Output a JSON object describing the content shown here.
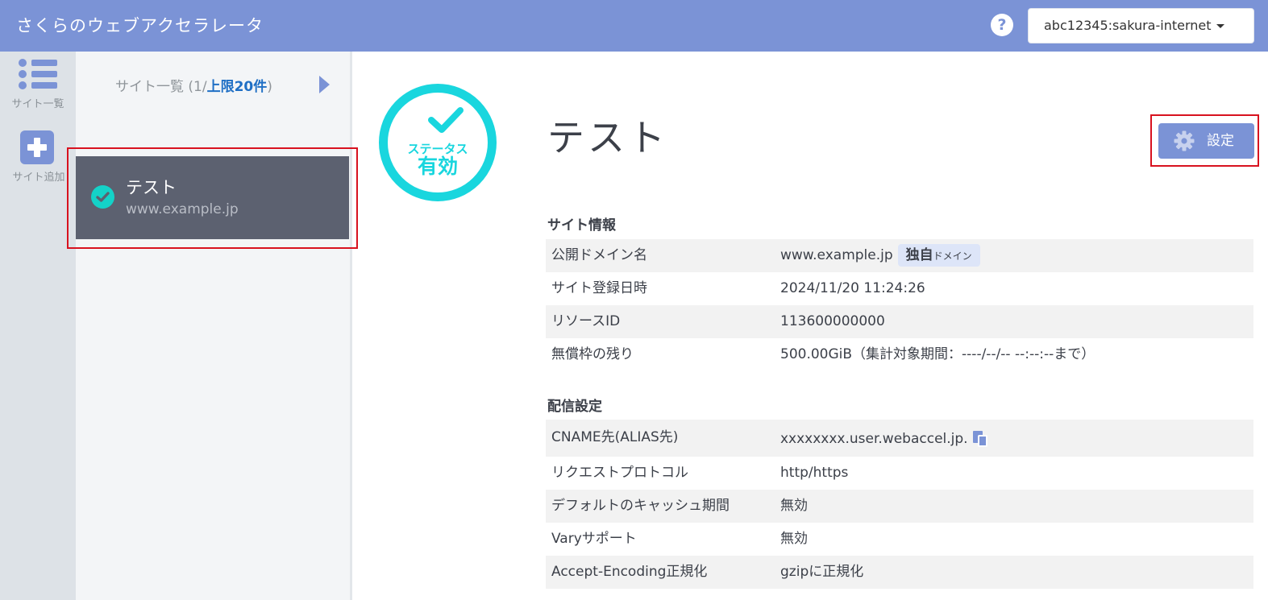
{
  "header": {
    "app_title": "さくらのウェブアクセラレータ",
    "help_glyph": "?",
    "account": "abc12345:sakura-internet"
  },
  "rail": {
    "site_list_label": "サイト一覧",
    "add_site_label": "サイト追加"
  },
  "site_panel": {
    "heading_prefix": "サイト一覧 (1/",
    "heading_limit": "上限20件",
    "heading_suffix": ")",
    "sites": [
      {
        "name": "テスト",
        "domain": "www.example.jp",
        "status": "active"
      }
    ]
  },
  "status": {
    "label": "ステータス",
    "value": "有効",
    "color": "#19d6de"
  },
  "main": {
    "title": "テスト",
    "settings_label": "設定"
  },
  "site_info": {
    "title": "サイト情報",
    "domain_label": "公開ドメイン名",
    "domain_value": "www.example.jp",
    "domain_tag_strong": "独自",
    "domain_tag_small": "ドメイン",
    "registered_label": "サイト登録日時",
    "registered_value": "2024/11/20 11:24:26",
    "resource_label": "リソースID",
    "resource_value": "113600000000",
    "quota_label": "無償枠の残り",
    "quota_value": "500.00GiB（集計対象期間：----/--/-- --:--:--まで）"
  },
  "delivery": {
    "title": "配信設定",
    "cname_label": "CNAME先(ALIAS先)",
    "cname_value": "xxxxxxxx.user.webaccel.jp.",
    "protocol_label": "リクエストプロトコル",
    "protocol_value": "http/https",
    "cache_label": "デフォルトのキャッシュ期間",
    "cache_value": "無効",
    "vary_label": "Varyサポート",
    "vary_value": "無効",
    "encoding_label": "Accept-Encoding正規化",
    "encoding_value": "gzipに正規化"
  },
  "colors": {
    "brand": "#7b93d6",
    "highlight": "#d8121f",
    "link": "#1f6fc5",
    "site_card": "#5c6170"
  },
  "icons": [
    "help-icon",
    "list-icon",
    "plus-icon",
    "chevron-right-icon",
    "check-circle-icon",
    "gear-icon",
    "copy-icon"
  ]
}
